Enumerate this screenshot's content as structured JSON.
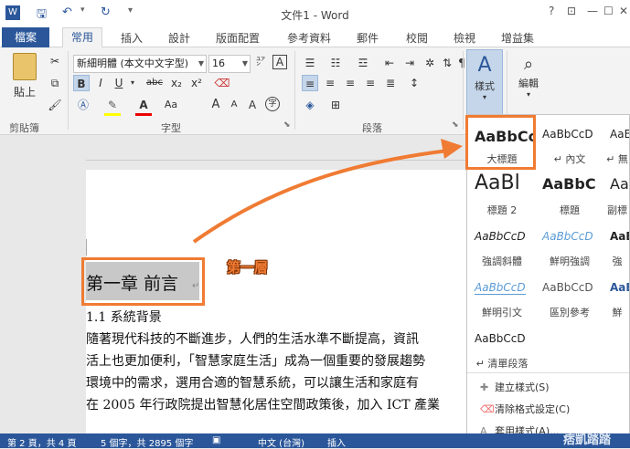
{
  "titlebar": {
    "title": "文件1 - Word",
    "help": "?",
    "minimize": "—",
    "restore": "☐",
    "close": "✕"
  },
  "tabs": [
    "檔案",
    "常用",
    "插入",
    "設計",
    "版面配置",
    "參考資料",
    "郵件",
    "校閱",
    "檢視",
    "增益集"
  ],
  "ribbon": {
    "clipboard": {
      "paste": "貼上",
      "label": "剪貼簿"
    },
    "font": {
      "name": "新細明體 (本文中文字型)",
      "size": "16",
      "label": "字型",
      "btn_font_size_unit": "A"
    },
    "paragraph": {
      "label": "段落"
    },
    "styles": {
      "label": "樣式"
    },
    "editing": {
      "label": "編輯"
    }
  },
  "document": {
    "heading": "第一章  前言",
    "heading_mark": "↵",
    "annotation": "第一層",
    "subheading": "1.1  系統背景",
    "lines": [
      "隨著現代科技的不斷進步，人們的生活水準不斷提高，資訊",
      "活上也更加便利，「智慧家庭生活」成為一個重要的發展趨勢",
      "環境中的需求，選用合適的智慧系統，可以讓生活和家庭有",
      "在 2005 年行政院提出智慧化居住空間政策後，加入 ICT 產業"
    ]
  },
  "gallery": {
    "items": [
      {
        "preview": "AaBbCc",
        "name": "大標題"
      },
      {
        "preview": "AaBbCcD",
        "name": "↵ 內文"
      },
      {
        "preview": "AaBbC",
        "name": "↵ 無"
      },
      {
        "preview": "AaBl",
        "name": "標題 2"
      },
      {
        "preview": "AaBbC",
        "name": "標題"
      },
      {
        "preview": "AaB",
        "name": "副標"
      },
      {
        "preview": "AaBbCcD",
        "name": "強調斜體"
      },
      {
        "preview": "AaBbCcD",
        "name": "鮮明強調"
      },
      {
        "preview": "AaB",
        "name": "強"
      },
      {
        "preview": "AaBbCcD",
        "name": "鮮明引文"
      },
      {
        "preview": "AaBbCcD",
        "name": "區別參考"
      },
      {
        "preview": "AaB",
        "name": "鮮"
      },
      {
        "preview": "AaBbCcD",
        "name": "↵ 清單段落"
      }
    ],
    "menu": [
      "建立樣式(S)",
      "清除格式設定(C)",
      "套用樣式(A)..."
    ]
  },
  "status": {
    "page": "第 2 頁，共 4 頁",
    "words": "5 個字，共 2895 個字",
    "lang": "中文 (台灣)",
    "mode": "插入",
    "watermark": "痞凱踏踏"
  },
  "colors": {
    "brand": "#2b579a",
    "highlight": "#f07b33"
  }
}
